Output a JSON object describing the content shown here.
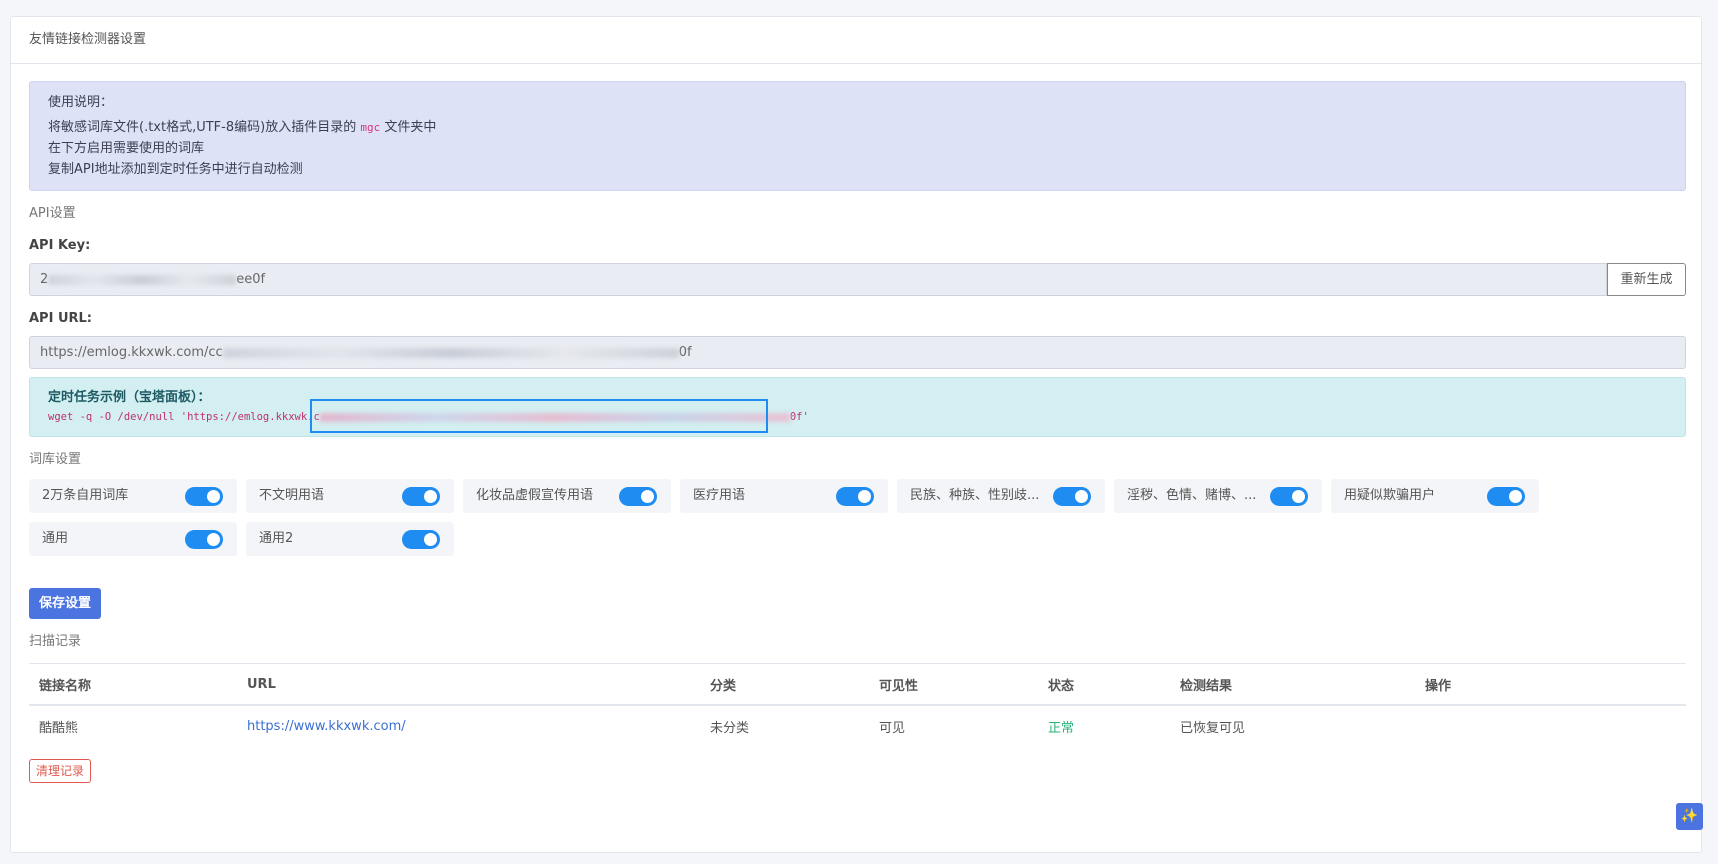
{
  "card": {
    "title": "友情链接检测器设置"
  },
  "usage": {
    "title": "使用说明：",
    "line1_prefix": "将敏感词库文件(.txt格式,UTF-8编码)放入插件目录的",
    "line1_code": "mgc",
    "line1_suffix": "文件夹中",
    "line2": "在下方启用需要使用的词库",
    "line3": "复制API地址添加到定时任务中进行自动检测"
  },
  "api": {
    "section_label": "API设置",
    "key_label": "API Key:",
    "key_prefix": "2",
    "key_suffix": "ee0f",
    "regen_button": "重新生成",
    "url_label": "API URL:",
    "url_prefix": "https://emlog.kkxwk.com/cc",
    "url_suffix": "0f"
  },
  "cron": {
    "title": "定时任务示例（宝塔面板）：",
    "cmd_prefix": "wget -q -O /dev/null 'https://emlog.kkxwk.c",
    "cmd_suffix": "0f'"
  },
  "dict": {
    "section_label": "词库设置",
    "items": [
      {
        "label": "2万条自用词库",
        "on": true
      },
      {
        "label": "不文明用语",
        "on": true
      },
      {
        "label": "化妆品虚假宣传用语",
        "on": true
      },
      {
        "label": "医疗用语",
        "on": true
      },
      {
        "label": "民族、种族、性别歧...",
        "on": true
      },
      {
        "label": "淫秽、色情、赌博、...",
        "on": true
      },
      {
        "label": "用疑似欺骗用户",
        "on": true
      },
      {
        "label": "通用",
        "on": true
      },
      {
        "label": "通用2",
        "on": true
      }
    ]
  },
  "save_button": "保存设置",
  "scan": {
    "section_label": "扫描记录",
    "columns": [
      "链接名称",
      "URL",
      "分类",
      "可见性",
      "状态",
      "检测结果",
      "操作"
    ],
    "rows": [
      {
        "name": "酷酷熊",
        "url": "https://www.kkxwk.com/",
        "category": "未分类",
        "visibility": "可见",
        "status": "正常",
        "result": "已恢复可见",
        "action": ""
      }
    ],
    "clear_button": "清理记录"
  },
  "colors": {
    "accent": "#1e8cf0",
    "primary": "#4b74e0",
    "success": "#29b37a",
    "danger": "#e05a4f"
  },
  "icons": {
    "float": "sparkle-icon"
  }
}
